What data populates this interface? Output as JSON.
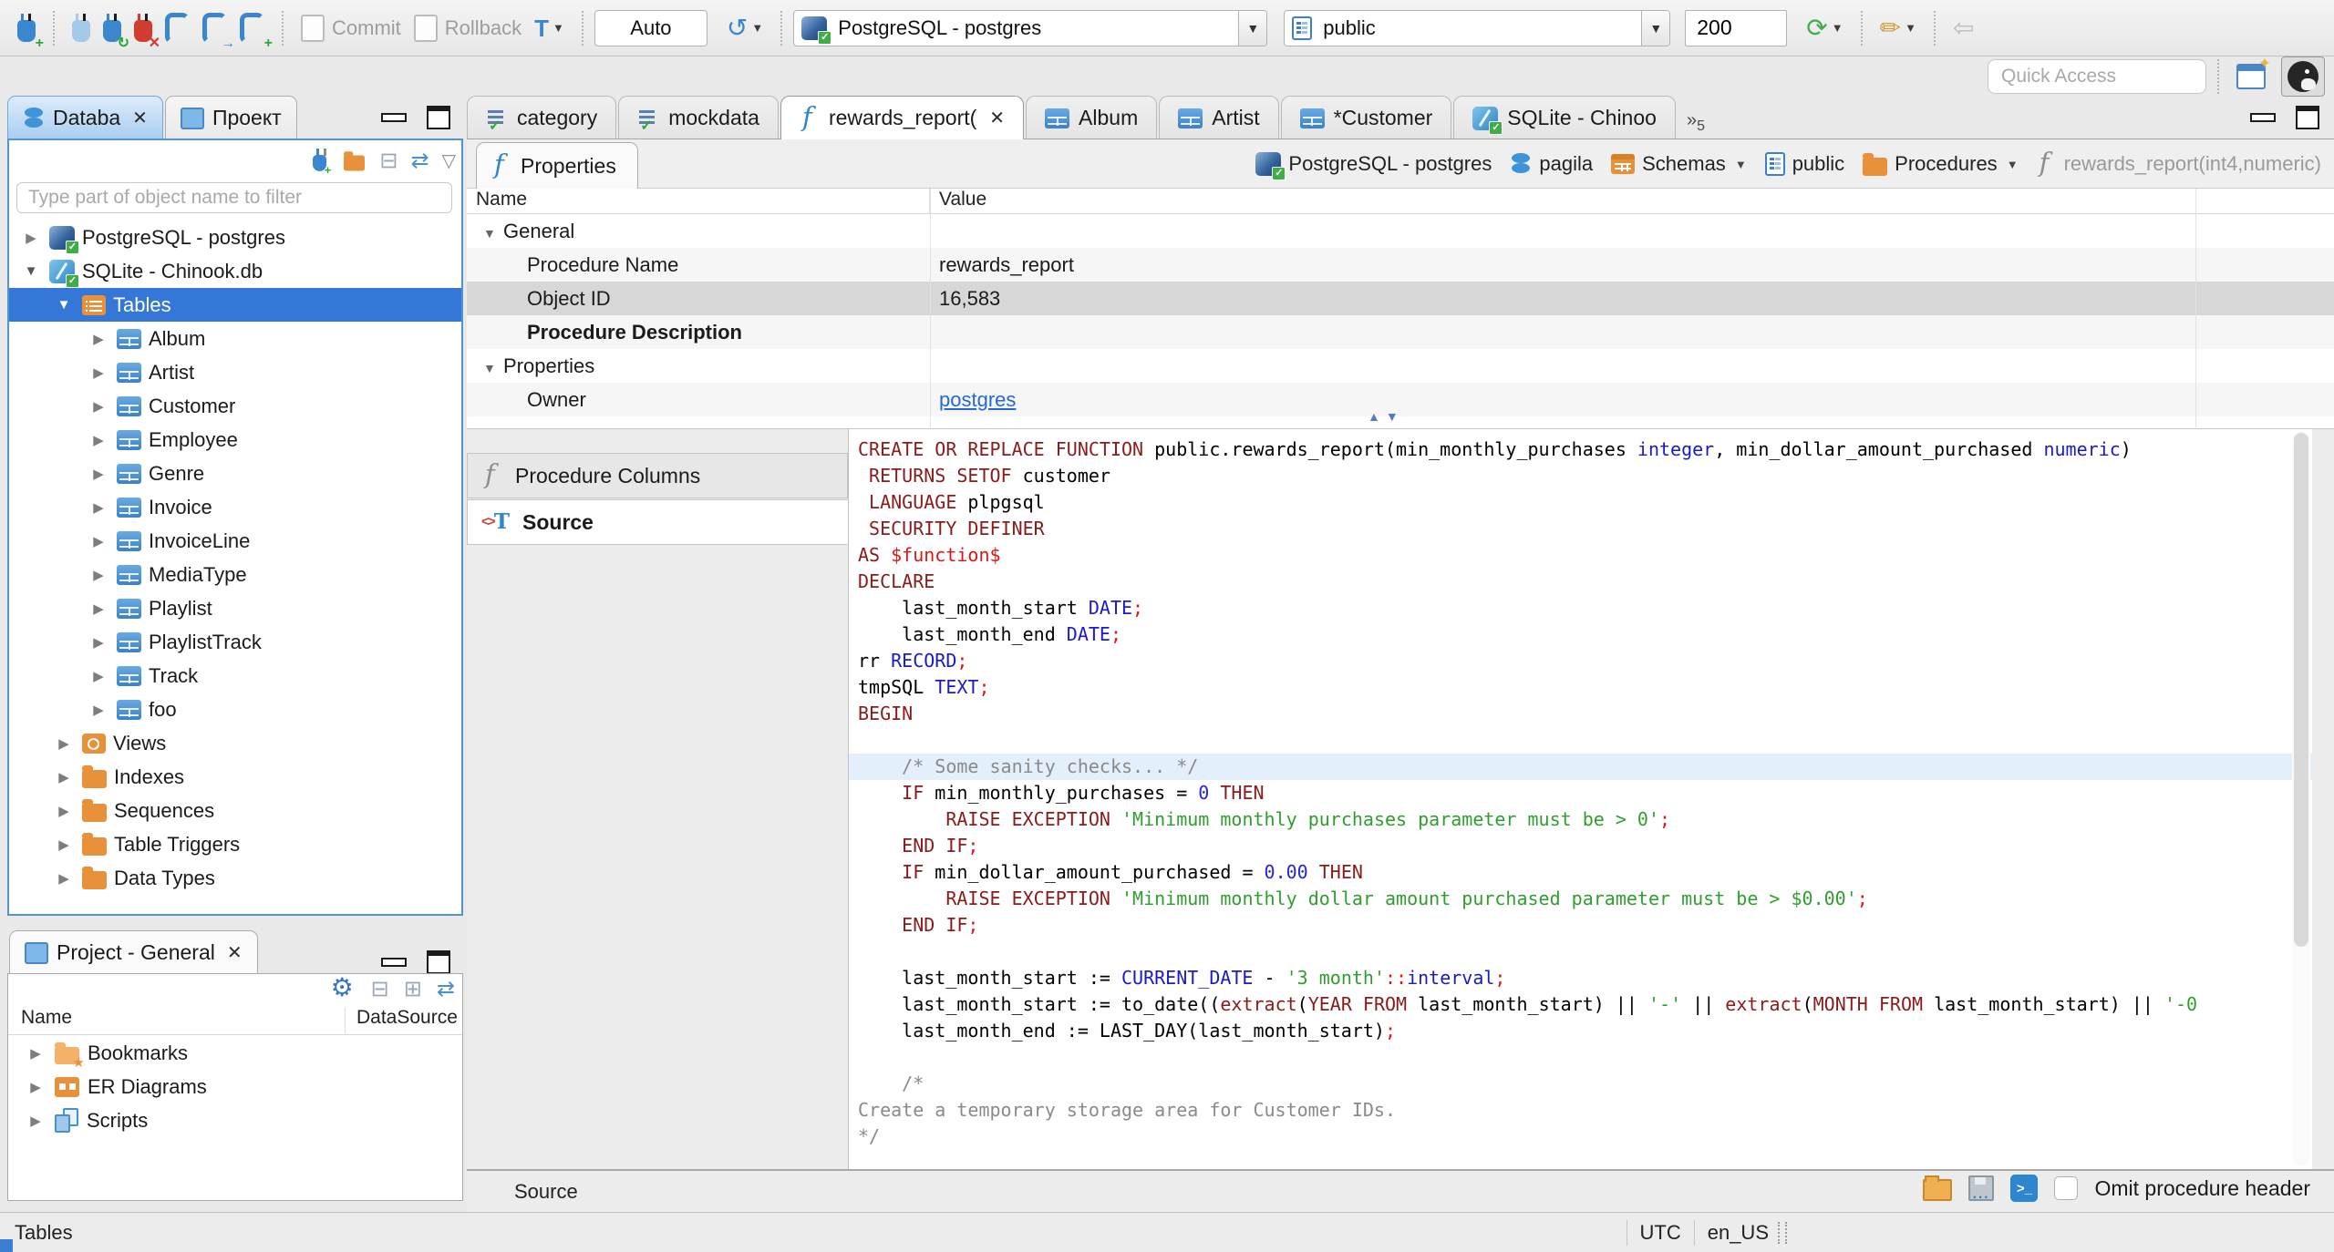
{
  "toolbar": {
    "commit_label": "Commit",
    "rollback_label": "Rollback",
    "txn_mode_icon": "T",
    "auto_label": "Auto",
    "connection": "PostgreSQL - postgres",
    "schema": "public",
    "fetch_size": "200",
    "quick_access_placeholder": "Quick Access"
  },
  "left": {
    "tabs": [
      {
        "label": "Databa"
      },
      {
        "label": "Проект"
      }
    ],
    "filter_placeholder": "Type part of object name to filter",
    "tree": [
      {
        "label": "PostgreSQL - postgres",
        "icon": "postgres",
        "level": 0,
        "expanded": false
      },
      {
        "label": "SQLite - Chinook.db",
        "icon": "sqlite",
        "level": 0,
        "expanded": true
      },
      {
        "label": "Tables",
        "icon": "tables-folder",
        "level": 1,
        "expanded": true,
        "selected": true
      },
      {
        "label": "Album",
        "icon": "table",
        "level": 2
      },
      {
        "label": "Artist",
        "icon": "table",
        "level": 2
      },
      {
        "label": "Customer",
        "icon": "table",
        "level": 2
      },
      {
        "label": "Employee",
        "icon": "table",
        "level": 2
      },
      {
        "label": "Genre",
        "icon": "table",
        "level": 2
      },
      {
        "label": "Invoice",
        "icon": "table",
        "level": 2
      },
      {
        "label": "InvoiceLine",
        "icon": "table",
        "level": 2
      },
      {
        "label": "MediaType",
        "icon": "table",
        "level": 2
      },
      {
        "label": "Playlist",
        "icon": "table",
        "level": 2
      },
      {
        "label": "PlaylistTrack",
        "icon": "table",
        "level": 2
      },
      {
        "label": "Track",
        "icon": "table",
        "level": 2
      },
      {
        "label": "foo",
        "icon": "table",
        "level": 2
      },
      {
        "label": "Views",
        "icon": "views",
        "level": 1
      },
      {
        "label": "Indexes",
        "icon": "folder",
        "level": 1
      },
      {
        "label": "Sequences",
        "icon": "folder",
        "level": 1
      },
      {
        "label": "Table Triggers",
        "icon": "folder",
        "level": 1
      },
      {
        "label": "Data Types",
        "icon": "folder",
        "level": 1
      }
    ]
  },
  "project": {
    "tab_label": "Project - General",
    "columns": {
      "name": "Name",
      "datasource": "DataSource"
    },
    "items": [
      {
        "label": "Bookmarks",
        "icon": "bookmarks-folder"
      },
      {
        "label": "ER Diagrams",
        "icon": "er-folder"
      },
      {
        "label": "Scripts",
        "icon": "scripts"
      }
    ]
  },
  "editor_tabs": [
    {
      "label": "category",
      "icon": "sql-script"
    },
    {
      "label": "mockdata",
      "icon": "sql-script"
    },
    {
      "label": "rewards_report(",
      "icon": "function",
      "active": true
    },
    {
      "label": "Album",
      "icon": "table"
    },
    {
      "label": "Artist",
      "icon": "table"
    },
    {
      "label": "*Customer",
      "icon": "table"
    },
    {
      "label": "SQLite - Chinoo",
      "icon": "sqlite"
    }
  ],
  "tab_overflow": {
    "chevron": "»",
    "count": "5"
  },
  "properties_view": {
    "tab_label": "Properties",
    "breadcrumb": [
      {
        "label": "PostgreSQL - postgres",
        "icon": "postgres"
      },
      {
        "label": "pagila",
        "icon": "database"
      },
      {
        "label": "Schemas",
        "icon": "schemas",
        "dropdown": true
      },
      {
        "label": "public",
        "icon": "schema"
      },
      {
        "label": "Procedures",
        "icon": "folder",
        "dropdown": true
      },
      {
        "label": "rewards_report(int4,numeric)",
        "icon": "function",
        "muted": true
      }
    ],
    "grid": {
      "columns": {
        "name": "Name",
        "value": "Value"
      },
      "rows": [
        {
          "name": "General",
          "value": "",
          "type": "group"
        },
        {
          "name": "Procedure Name",
          "value": "rewards_report"
        },
        {
          "name": "Object ID",
          "value": "16,583",
          "selected": true
        },
        {
          "name": "Procedure Description",
          "value": "",
          "bold": true
        },
        {
          "name": "Properties",
          "value": "",
          "type": "group"
        },
        {
          "name": "Owner",
          "value": "postgres",
          "link": true
        }
      ]
    },
    "side_tabs": [
      {
        "label": "Procedure Columns",
        "icon": "function"
      },
      {
        "label": "Source",
        "icon": "source",
        "active": true
      }
    ],
    "status_label": "Source",
    "omit_checkbox_label": "Omit procedure header"
  },
  "source_code": {
    "lines": [
      {
        "seg": [
          [
            "k",
            "CREATE OR REPLACE FUNCTION "
          ],
          [
            "p",
            "public.rewards_report(min_monthly_purchases "
          ],
          [
            "t",
            "integer"
          ],
          [
            "p",
            ", min_dollar_amount_purchased "
          ],
          [
            "t",
            "numeric"
          ],
          [
            "p",
            ")"
          ]
        ]
      },
      {
        "seg": [
          [
            "p",
            " "
          ],
          [
            "k",
            "RETURNS SETOF"
          ],
          [
            "p",
            " customer"
          ]
        ]
      },
      {
        "seg": [
          [
            "p",
            " "
          ],
          [
            "k",
            "LANGUAGE"
          ],
          [
            "p",
            " plpgsql"
          ]
        ]
      },
      {
        "seg": [
          [
            "p",
            " "
          ],
          [
            "k",
            "SECURITY DEFINER"
          ]
        ]
      },
      {
        "seg": [
          [
            "k",
            "AS "
          ],
          [
            "r",
            "$function$"
          ]
        ]
      },
      {
        "seg": [
          [
            "k",
            "DECLARE"
          ]
        ]
      },
      {
        "seg": [
          [
            "p",
            "    last_month_start "
          ],
          [
            "t",
            "DATE"
          ],
          [
            "r",
            ";"
          ]
        ]
      },
      {
        "seg": [
          [
            "p",
            "    last_month_end "
          ],
          [
            "t",
            "DATE"
          ],
          [
            "r",
            ";"
          ]
        ]
      },
      {
        "seg": [
          [
            "p",
            "rr "
          ],
          [
            "t",
            "RECORD"
          ],
          [
            "r",
            ";"
          ]
        ]
      },
      {
        "seg": [
          [
            "p",
            "tmpSQL "
          ],
          [
            "t",
            "TEXT"
          ],
          [
            "r",
            ";"
          ]
        ]
      },
      {
        "seg": [
          [
            "k",
            "BEGIN"
          ]
        ]
      },
      {
        "seg": []
      },
      {
        "hl": true,
        "seg": [
          [
            "c",
            "    /* Some sanity checks... */"
          ]
        ]
      },
      {
        "seg": [
          [
            "p",
            "    "
          ],
          [
            "k",
            "IF"
          ],
          [
            "p",
            " min_monthly_purchases = "
          ],
          [
            "n",
            "0"
          ],
          [
            "p",
            " "
          ],
          [
            "k",
            "THEN"
          ]
        ]
      },
      {
        "seg": [
          [
            "p",
            "        "
          ],
          [
            "k",
            "RAISE EXCEPTION"
          ],
          [
            "p",
            " "
          ],
          [
            "s",
            "'Minimum monthly purchases parameter must be > 0'"
          ],
          [
            "r",
            ";"
          ]
        ]
      },
      {
        "seg": [
          [
            "p",
            "    "
          ],
          [
            "k",
            "END IF"
          ],
          [
            "r",
            ";"
          ]
        ]
      },
      {
        "seg": [
          [
            "p",
            "    "
          ],
          [
            "k",
            "IF"
          ],
          [
            "p",
            " min_dollar_amount_purchased = "
          ],
          [
            "n",
            "0.00"
          ],
          [
            "p",
            " "
          ],
          [
            "k",
            "THEN"
          ]
        ]
      },
      {
        "seg": [
          [
            "p",
            "        "
          ],
          [
            "k",
            "RAISE EXCEPTION"
          ],
          [
            "p",
            " "
          ],
          [
            "s",
            "'Minimum monthly dollar amount purchased parameter must be > $0.00'"
          ],
          [
            "r",
            ";"
          ]
        ]
      },
      {
        "seg": [
          [
            "p",
            "    "
          ],
          [
            "k",
            "END IF"
          ],
          [
            "r",
            ";"
          ]
        ]
      },
      {
        "seg": []
      },
      {
        "seg": [
          [
            "p",
            "    last_month_start := "
          ],
          [
            "t",
            "CURRENT_DATE"
          ],
          [
            "p",
            " - "
          ],
          [
            "s",
            "'3 month'"
          ],
          [
            "r",
            "::"
          ],
          [
            "t",
            "interval"
          ],
          [
            "r",
            ";"
          ]
        ]
      },
      {
        "seg": [
          [
            "p",
            "    last_month_start := to_date(("
          ],
          [
            "k",
            "extract"
          ],
          [
            "p",
            "("
          ],
          [
            "k",
            "YEAR FROM"
          ],
          [
            "p",
            " last_month_start) || "
          ],
          [
            "s",
            "'-'"
          ],
          [
            "p",
            " || "
          ],
          [
            "k",
            "extract"
          ],
          [
            "p",
            "("
          ],
          [
            "k",
            "MONTH FROM"
          ],
          [
            "p",
            " last_month_start) || "
          ],
          [
            "s",
            "'-0"
          ]
        ]
      },
      {
        "seg": [
          [
            "p",
            "    last_month_end := LAST_DAY(last_month_start)"
          ],
          [
            "r",
            ";"
          ]
        ]
      },
      {
        "seg": []
      },
      {
        "seg": [
          [
            "c",
            "    /*"
          ]
        ]
      },
      {
        "seg": [
          [
            "c",
            "Create a temporary storage area for Customer IDs."
          ]
        ]
      },
      {
        "seg": [
          [
            "c",
            "*/"
          ]
        ]
      }
    ]
  },
  "statusbar": {
    "left": "Tables",
    "timezone": "UTC",
    "locale": "en_US"
  },
  "colors": {
    "accent_blue": "#3477d6",
    "keyword": "#8b1a1a",
    "string": "#2f9e2f",
    "type": "#1a1acd",
    "comment": "#8a8a8a",
    "highlight_line": "#e3effb",
    "folder_orange": "#e8913a"
  }
}
